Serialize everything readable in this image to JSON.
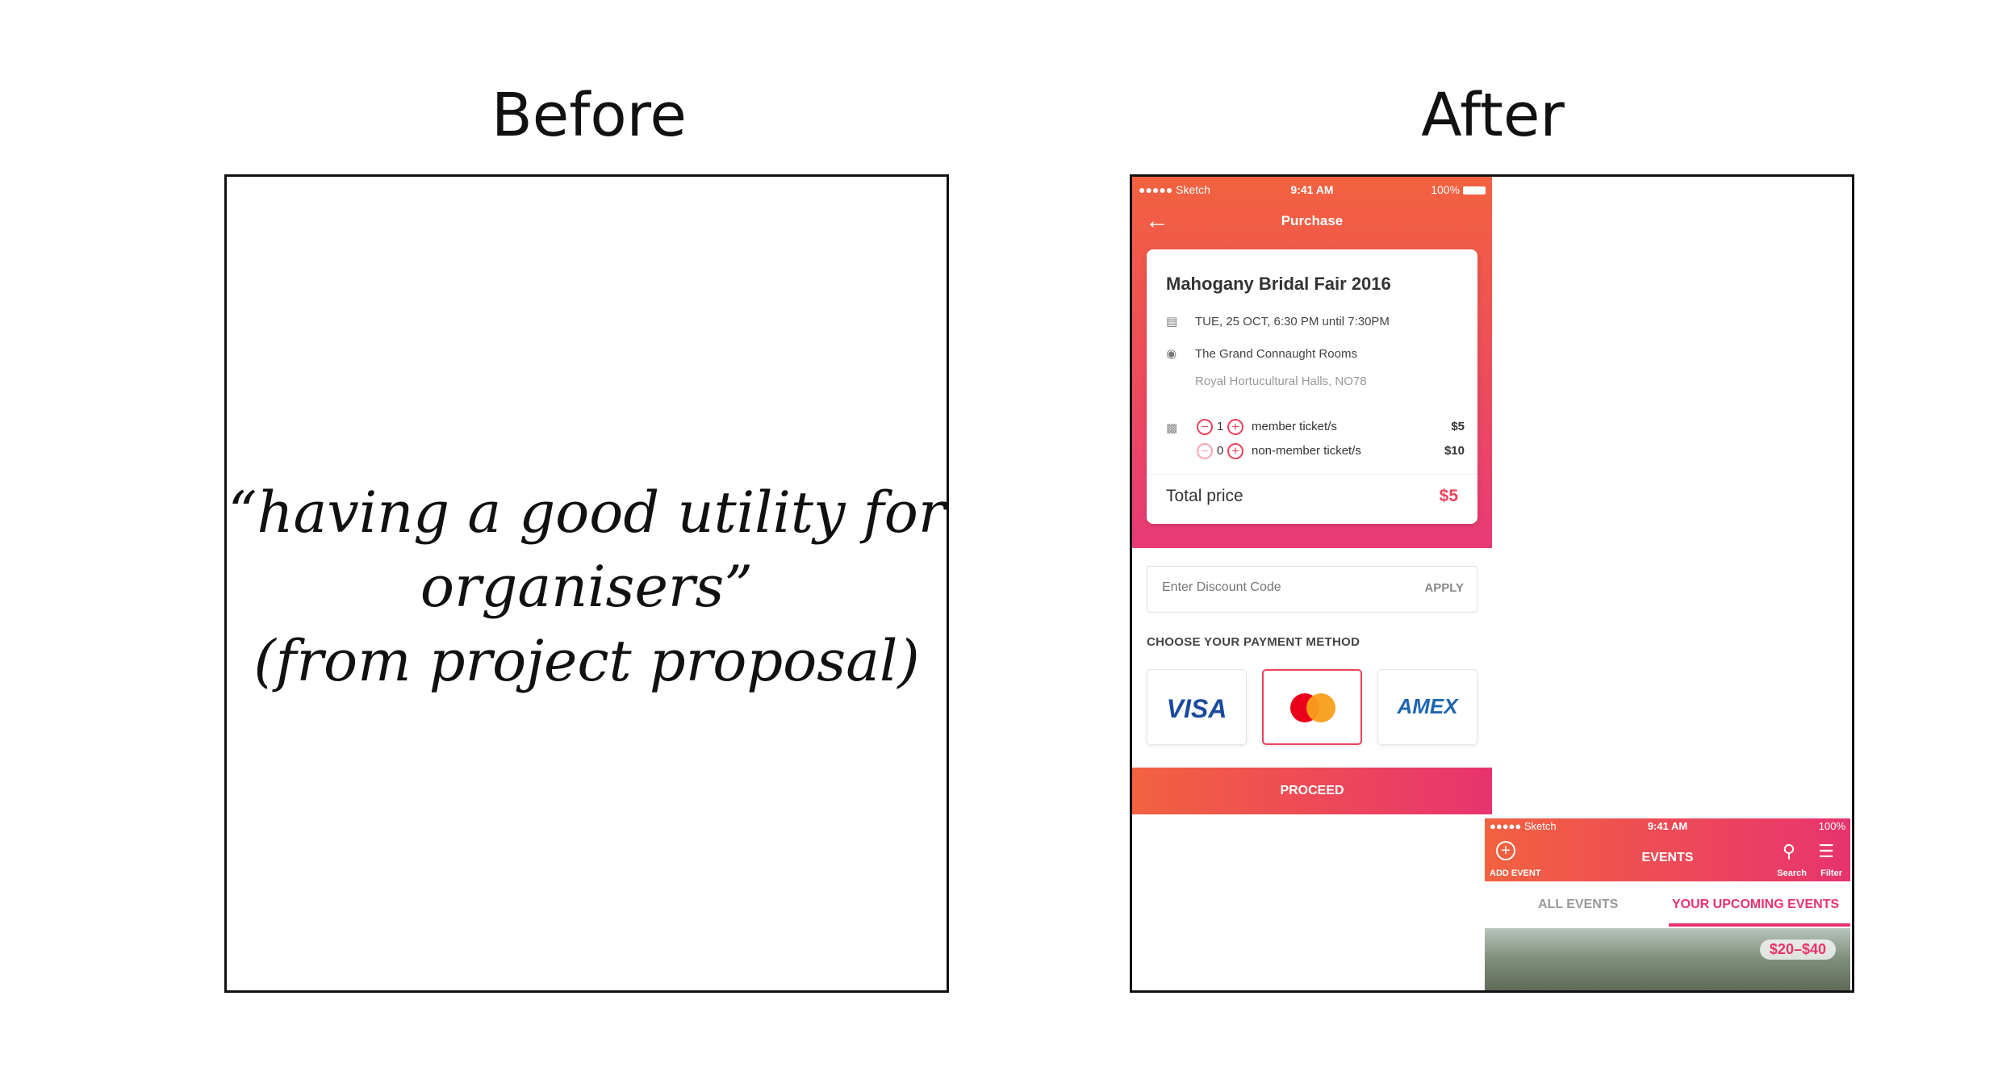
{
  "headings": {
    "before": "Before",
    "after": "After"
  },
  "quote": {
    "line1": "“having a good utility for",
    "line2": "organisers”",
    "line3": "(from project proposal)"
  },
  "purchase": {
    "status": {
      "carrier": "●●●●● Sketch",
      "time": "9:41 AM",
      "battery": "100%"
    },
    "title": "Purchase",
    "event_title": "Mahogany Bridal Fair 2016",
    "datetime": "TUE, 25 OCT, 6:30 PM until 7:30PM",
    "venue": "The Grand Connaught Rooms",
    "venue_sub": "Royal Hortucultural Halls, NO78",
    "tickets": [
      {
        "qty": "1",
        "label": "member ticket/s",
        "price": "$5"
      },
      {
        "qty": "0",
        "label": "non-member ticket/s",
        "price": "$10"
      }
    ],
    "total_label": "Total price",
    "total_value": "$5",
    "discount_placeholder": "Enter Discount Code",
    "apply_label": "APPLY",
    "payment_label": "CHOOSE YOUR PAYMENT METHOD",
    "payments": {
      "visa": "VISA",
      "amex": "AMEX"
    },
    "proceed_label": "PROCEED",
    "colors": {
      "accent": "#e8435e",
      "gradient_start": "#f2623f",
      "gradient_end": "#e8336f"
    }
  },
  "events": {
    "status": {
      "carrier": "●●●●● Sketch",
      "time": "9:41 AM",
      "battery": "100%"
    },
    "title": "EVENTS",
    "add_label": "ADD EVENT",
    "search_label": "Search",
    "filter_label": "Filter",
    "tabs": [
      "ALL EVENTS",
      "YOUR UPCOMING EVENTS"
    ],
    "price_badge": "$20–$40"
  }
}
